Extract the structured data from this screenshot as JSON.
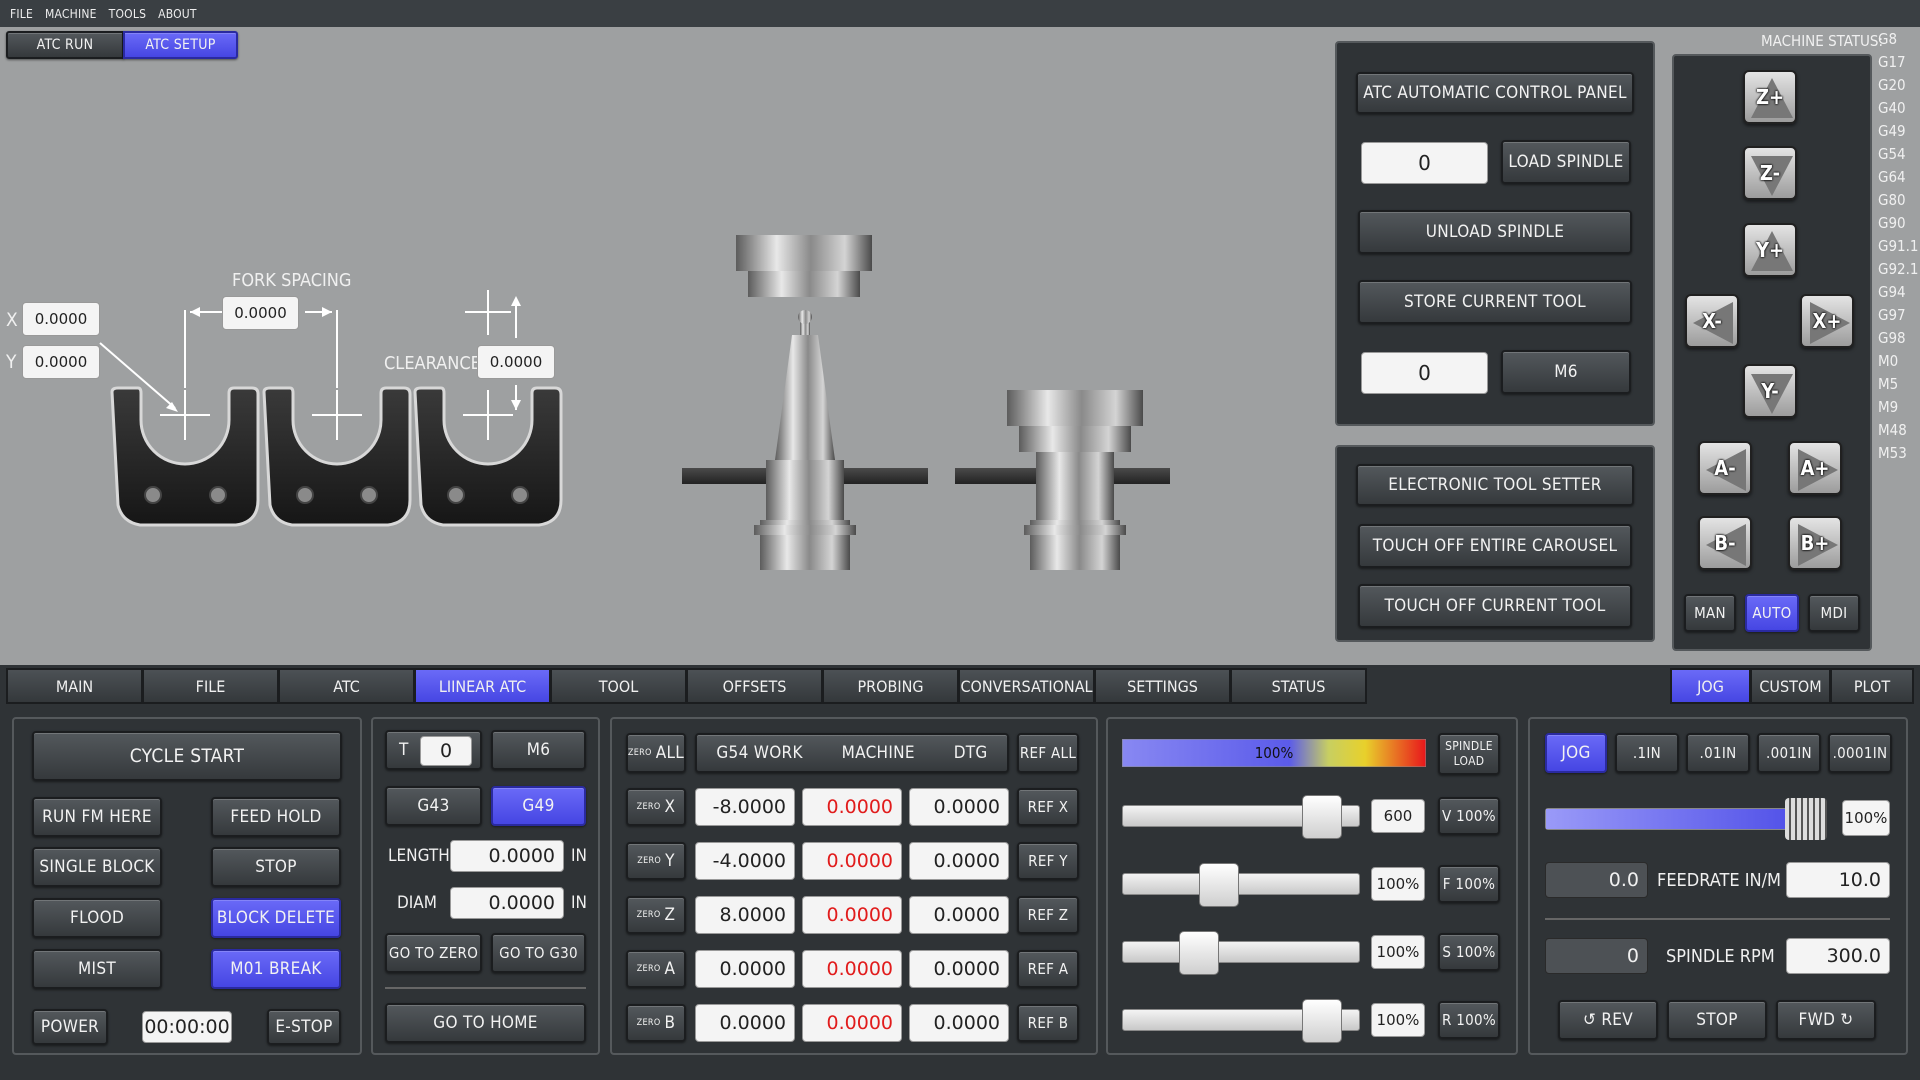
{
  "menu": [
    "FILE",
    "MACHINE",
    "TOOLS",
    "ABOUT"
  ],
  "top_tabs": [
    "ATC RUN",
    "ATC SETUP"
  ],
  "diagram": {
    "x_label": "X",
    "x_value": "0.0000",
    "y_label": "Y",
    "y_value": "0.0000",
    "fork_spacing_label": "FORK SPACING",
    "fork_spacing_value": "0.0000",
    "clearance_label": "CLEARANCE",
    "clearance_value": "0.0000"
  },
  "atc_panel": {
    "title": "ATC AUTOMATIC CONTROL PANEL",
    "tool_input": "0",
    "load_spindle": "LOAD SPINDLE",
    "unload_spindle": "UNLOAD SPINDLE",
    "store_current_tool": "STORE CURRENT TOOL",
    "m6_input": "0",
    "m6": "M6"
  },
  "tool_setter": {
    "title": "ELECTRONIC TOOL SETTER",
    "touch_carousel": "TOUCH OFF ENTIRE CAROUSEL",
    "touch_current": "TOUCH OFF CURRENT TOOL"
  },
  "machine_status": {
    "title": "MACHINE STATUS:",
    "codes": [
      "G8",
      "G17",
      "G20",
      "G40",
      "G49",
      "G54",
      "G64",
      "G80",
      "G90",
      "G91.1",
      "G92.1",
      "G94",
      "G97",
      "G98",
      "M0",
      "M5",
      "M9",
      "M48",
      "M53"
    ]
  },
  "jog_buttons": {
    "zp": "Z+",
    "zm": "Z-",
    "yp": "Y+",
    "ym": "Y-",
    "xm": "X-",
    "xp": "X+",
    "am": "A-",
    "ap": "A+",
    "bm": "B-",
    "bp": "B+"
  },
  "modes": [
    "MAN",
    "AUTO",
    "MDI"
  ],
  "main_tabs": [
    "MAIN",
    "FILE",
    "ATC",
    "LIINEAR ATC",
    "TOOL",
    "OFFSETS",
    "PROBING",
    "CONVERSATIONAL",
    "SETTINGS",
    "STATUS"
  ],
  "right_tabs": [
    "JOG",
    "CUSTOM",
    "PLOT"
  ],
  "cycle": {
    "cycle_start": "CYCLE START",
    "run_from_here": "RUN FM HERE",
    "feed_hold": "FEED HOLD",
    "single_block": "SINGLE BLOCK",
    "stop": "STOP",
    "flood": "FLOOD",
    "block_delete": "BLOCK DELETE",
    "mist": "MIST",
    "m01_break": "M01 BREAK",
    "power": "POWER",
    "timer": "00:00:00",
    "estop": "E-STOP"
  },
  "tool": {
    "t_label": "T",
    "t_value": "0",
    "m6": "M6",
    "g43": "G43",
    "g49": "G49",
    "length_label": "LENGTH",
    "length_value": "0.0000",
    "length_unit": "IN",
    "diam_label": "DIAM",
    "diam_value": "0.0000",
    "diam_unit": "IN",
    "go_to_zero": "GO TO ZERO",
    "go_to_g30": "GO TO G30",
    "go_to_home": "GO TO HOME"
  },
  "dro": {
    "zero_all_small": "ZERO",
    "zero_all": "ALL",
    "col_work": "G54 WORK",
    "col_machine": "MACHINE",
    "col_dtg": "DTG",
    "ref_all": "REF ALL",
    "zero_small": "ZERO",
    "axes": [
      {
        "axis": "X",
        "work": "-8.0000",
        "machine": "0.0000",
        "dtg": "0.0000",
        "ref": "REF X"
      },
      {
        "axis": "Y",
        "work": "-4.0000",
        "machine": "0.0000",
        "dtg": "0.0000",
        "ref": "REF Y"
      },
      {
        "axis": "Z",
        "work": "8.0000",
        "machine": "0.0000",
        "dtg": "0.0000",
        "ref": "REF Z"
      },
      {
        "axis": "A",
        "work": "0.0000",
        "machine": "0.0000",
        "dtg": "0.0000",
        "ref": "REF A"
      },
      {
        "axis": "B",
        "work": "0.0000",
        "machine": "0.0000",
        "dtg": "0.0000",
        "ref": "REF B"
      }
    ]
  },
  "overrides": {
    "spindle_load_pct": "100%",
    "spindle_load_fraction": 0.65,
    "spindle_load_label_1": "SPINDLE",
    "spindle_load_label_2": "LOAD",
    "rows": [
      {
        "value": "600",
        "button": "V 100%",
        "fraction": 0.91
      },
      {
        "value": "100%",
        "button": "F 100%",
        "fraction": 0.39
      },
      {
        "value": "100%",
        "button": "S 100%",
        "fraction": 0.29
      },
      {
        "value": "100%",
        "button": "R 100%",
        "fraction": 0.91
      }
    ]
  },
  "jog": {
    "jog": "JOG",
    "steps": [
      ".1IN",
      ".01IN",
      ".001IN",
      ".0001IN"
    ],
    "jog_pct": "100%",
    "jog_fraction": 0.9,
    "feed_actual": "0.0",
    "feed_label": "FEEDRATE IN/M",
    "feed_set": "10.0",
    "rpm_actual": "0",
    "rpm_label": "SPINDLE RPM",
    "rpm_set": "300.0",
    "rev": "REV",
    "stop": "STOP",
    "fwd": "FWD"
  },
  "colors": {
    "accent": "#5656ee",
    "machine_value": "#e11c1c"
  }
}
